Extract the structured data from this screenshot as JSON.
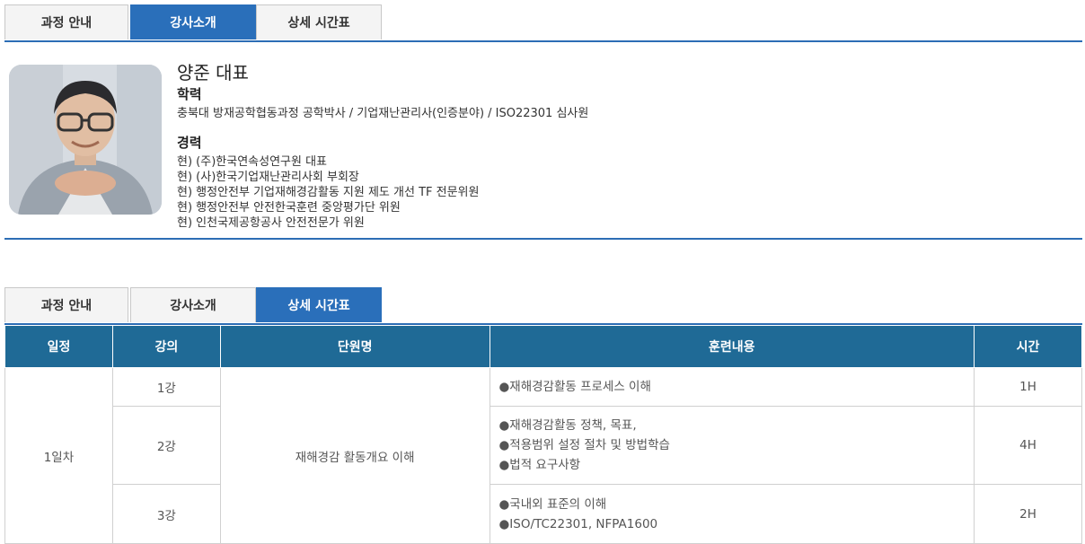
{
  "tabs": [
    "과정 안내",
    "강사소개",
    "상세 시간표"
  ],
  "instructor": {
    "name": "양준 대표",
    "education_title": "학력",
    "education": "충북대 방재공학협동과정 공학박사 / 기업재난관리사(인증분야) / ISO22301 심사원",
    "career_title": "경력",
    "career": [
      "현) (주)한국연속성연구원 대표",
      "현) (사)한국기업재난관리사회 부회장",
      "현) 행정안전부 기업재해경감활동 지원 제도 개선 TF 전문위원",
      "현) 행정안전부 안전한국훈련 중앙평가단 위원",
      "현) 인천국제공항공사 안전전문가 위원"
    ]
  },
  "schedule": {
    "headers": [
      "일정",
      "강의",
      "단원명",
      "훈련내용",
      "시간"
    ],
    "day": "1일차",
    "unit": "재해경감 활동개요 이해",
    "rows": [
      {
        "lecture": "1강",
        "items": [
          "●재해경감활동 프로세스 이해"
        ],
        "time": "1H"
      },
      {
        "lecture": "2강",
        "items": [
          "●재해경감활동 정책, 목표,",
          "●적용범위 설정 절차 및 방법학습",
          "●법적 요구사항"
        ],
        "time": "4H"
      },
      {
        "lecture": "3강",
        "items": [
          "●국내외 표준의 이해",
          "●ISO/TC22301, NFPA1600"
        ],
        "time": "2H"
      }
    ]
  },
  "colors": {
    "tab_active": "#2a6fba",
    "header_bg": "#1f6a96",
    "divider": "#2c6db5"
  }
}
